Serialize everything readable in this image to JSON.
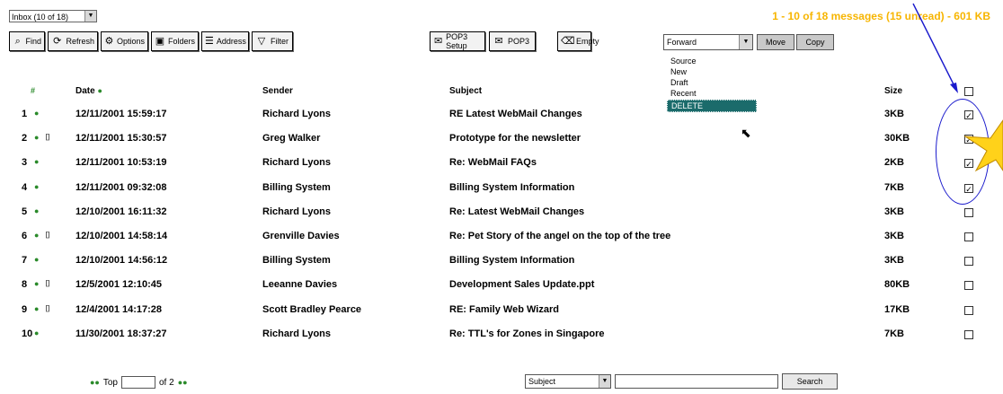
{
  "folder_select": {
    "value": "Inbox (10 of 18)"
  },
  "toolbar": [
    {
      "name": "find-button",
      "icon": "search-icon",
      "label": "Find"
    },
    {
      "name": "refresh-button",
      "icon": "refresh-icon",
      "label": "Refresh"
    },
    {
      "name": "options-button",
      "icon": "options-icon",
      "label": "Options"
    },
    {
      "name": "folders-button",
      "icon": "folder-icon",
      "label": "Folders"
    },
    {
      "name": "address-button",
      "icon": "address-book-icon",
      "label": "Address"
    },
    {
      "name": "filter-button",
      "icon": "filter-icon",
      "label": "Filter"
    },
    {
      "name": "pop3-setup-button",
      "icon": "pop3-setup-icon",
      "label": "POP3 Setup"
    },
    {
      "name": "pop3-button",
      "icon": "pop3-icon",
      "label": "POP3"
    },
    {
      "name": "empty-button",
      "icon": "trash-icon",
      "label": "Empty"
    }
  ],
  "summary": "1 - 10 of 18 messages (15 unread) - 601 KB",
  "action_select": {
    "value": "Forward"
  },
  "move_label": "Move",
  "copy_label": "Copy",
  "dropdown_options": [
    "Forward",
    "Source",
    "New",
    "Draft",
    "Recent",
    "DELETE"
  ],
  "headers": {
    "num": "#",
    "date": "Date",
    "sender": "Sender",
    "subject": "Subject",
    "size": "Size"
  },
  "messages": [
    {
      "num": "1",
      "date": "12/11/2001 15:59:17",
      "sender": "Richard Lyons",
      "subject": "RE Latest WebMail Changes",
      "size": "3KB",
      "checked": true,
      "attach": false
    },
    {
      "num": "2",
      "date": "12/11/2001 15:30:57",
      "sender": "Greg Walker",
      "subject": "Prototype for the newsletter",
      "size": "30KB",
      "checked": true,
      "attach": true
    },
    {
      "num": "3",
      "date": "12/11/2001 10:53:19",
      "sender": "Richard Lyons",
      "subject": "Re: WebMail FAQs",
      "size": "2KB",
      "checked": true,
      "attach": false
    },
    {
      "num": "4",
      "date": "12/11/2001 09:32:08",
      "sender": "Billing System",
      "subject": "Billing System Information",
      "size": "7KB",
      "checked": true,
      "attach": false
    },
    {
      "num": "5",
      "date": "12/10/2001 16:11:32",
      "sender": "Richard Lyons",
      "subject": "Re: Latest WebMail Changes",
      "size": "3KB",
      "checked": false,
      "attach": false
    },
    {
      "num": "6",
      "date": "12/10/2001 14:58:14",
      "sender": "Grenville Davies",
      "subject": "Re: Pet Story of the angel on the top of the tree",
      "size": "3KB",
      "checked": false,
      "attach": true
    },
    {
      "num": "7",
      "date": "12/10/2001 14:56:12",
      "sender": "Billing System",
      "subject": "Billing System Information",
      "size": "3KB",
      "checked": false,
      "attach": false
    },
    {
      "num": "8",
      "date": "12/5/2001 12:10:45",
      "sender": "Leeanne Davies",
      "subject": "Development Sales Update.ppt",
      "size": "80KB",
      "checked": false,
      "attach": true
    },
    {
      "num": "9",
      "date": "12/4/2001 14:17:28",
      "sender": "Scott Bradley Pearce",
      "subject": "RE: Family Web Wizard",
      "size": "17KB",
      "checked": false,
      "attach": true
    },
    {
      "num": "10",
      "date": "11/30/2001 18:37:27",
      "sender": "Richard Lyons",
      "subject": "Re: TTL's for Zones in Singapore",
      "size": "7KB",
      "checked": false,
      "attach": false
    }
  ],
  "pager": {
    "top_label": "Top",
    "of_label": "of 2"
  },
  "search": {
    "by": "Subject",
    "button": "Search"
  },
  "colors": {
    "summary": "#f7b500",
    "annotation": "#1a1acc",
    "star": "#ffd21a",
    "selected_option": "#1b6b6b"
  }
}
